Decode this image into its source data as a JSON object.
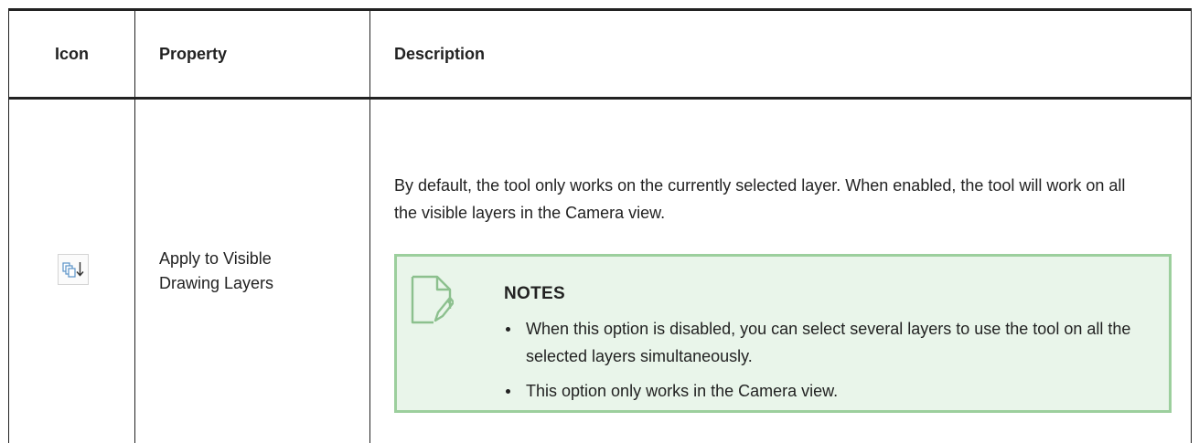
{
  "table": {
    "headers": {
      "icon": "Icon",
      "property": "Property",
      "description": "Description"
    },
    "rows": [
      {
        "icon_name": "apply-to-visible-layers-icon",
        "property": "Apply to Visible Drawing Layers",
        "description": "By default, the tool only works on the currently selected layer. When enabled, the tool will work on all the visible layers in the Camera view.",
        "note": {
          "title": "NOTES",
          "items": [
            "When this option is disabled, you can select several layers to use the tool on all the selected layers simultaneously.",
            "This option only works in the Camera view."
          ]
        }
      }
    ]
  },
  "colors": {
    "note_background": "#e9f5ea",
    "note_border": "#9ccf9d",
    "note_icon": "#8cc08e",
    "tool_icon_blue": "#5b93c7"
  }
}
